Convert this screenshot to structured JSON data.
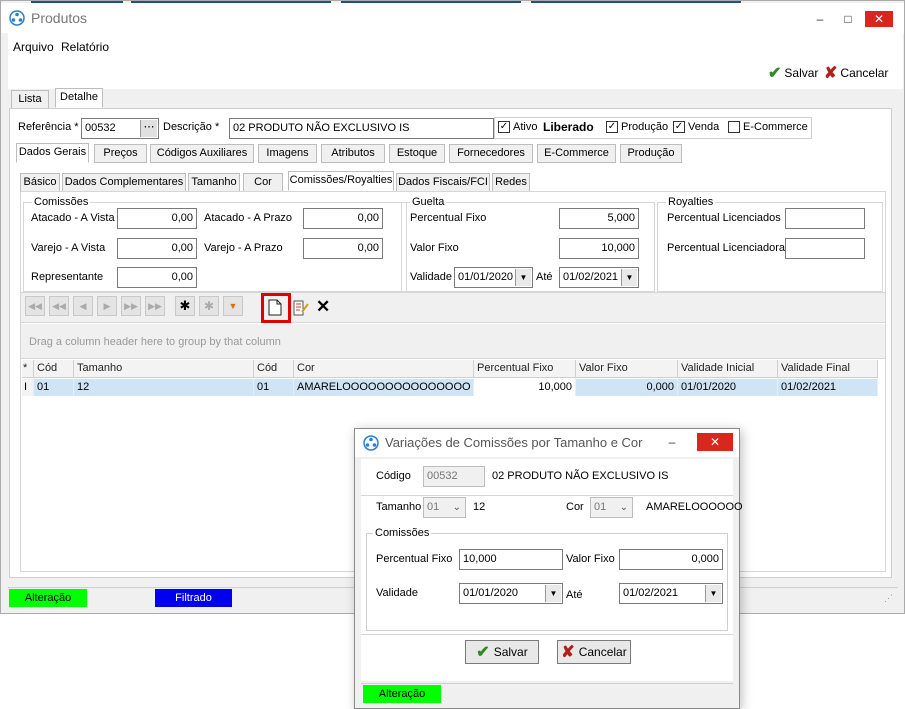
{
  "window": {
    "title": "Produtos"
  },
  "menu": {
    "arquivo": "Arquivo",
    "relatorio": "Relatório"
  },
  "toolbar": {
    "save_label": "Salvar",
    "cancel_label": "Cancelar"
  },
  "view_tabs": [
    "Lista",
    "Detalhe"
  ],
  "header": {
    "referencia_label": "Referência *",
    "referencia_value": "00532",
    "descricao_label": "Descrição *",
    "descricao_value": "02 PRODUTO NÃO EXCLUSIVO IS",
    "ativo_label": "Ativo",
    "status_text": "Liberado",
    "producao_label": "Produção",
    "venda_label": "Venda",
    "ecommerce_label": "E-Commerce"
  },
  "main_tabs": [
    "Dados Gerais",
    "Preços",
    "Códigos Auxiliares",
    "Imagens",
    "Atributos",
    "Estoque",
    "Fornecedores",
    "E-Commerce",
    "Produção"
  ],
  "sub_tabs": [
    "Básico",
    "Dados Complementares",
    "Tamanho",
    "Cor",
    "Comissões/Royalties",
    "Dados Fiscais/FCI",
    "Redes"
  ],
  "comissoes": {
    "title": "Comissões",
    "atacado_vista_label": "Atacado - A Vista",
    "atacado_vista": "0,00",
    "atacado_prazo_label": "Atacado - A Prazo",
    "atacado_prazo": "0,00",
    "varejo_vista_label": "Varejo - A Vista",
    "varejo_vista": "0,00",
    "varejo_prazo_label": "Varejo - A Prazo",
    "varejo_prazo": "0,00",
    "representante_label": "Representante",
    "representante": "0,00"
  },
  "guelta": {
    "title": "Guelta",
    "percentual_label": "Percentual Fixo",
    "percentual": "5,000",
    "valor_label": "Valor Fixo",
    "valor": "10,000",
    "validade_label": "Validade",
    "validade": "01/01/2020",
    "ate_label": "Até",
    "ate": "01/02/2021"
  },
  "royalties": {
    "title": "Royalties",
    "licenciados_label": "Percentual Licenciados",
    "licenciados": "",
    "licenciadora_label": "Percentual Licenciadora",
    "licenciadora": ""
  },
  "grid": {
    "group_hint": "Drag a column header here to group by that column",
    "columns": [
      "*",
      "Cód",
      "Tamanho",
      "Cód",
      "Cor",
      "Percentual Fixo",
      "Valor Fixo",
      "Validade Inicial",
      "Validade Final"
    ],
    "row": {
      "indicator": "I",
      "cod_tam": "01",
      "tamanho": "12",
      "cod_cor": "01",
      "cor": "AMARELOOOOOOOOOOOOOOO",
      "percentual": "10,000",
      "valor": "0,000",
      "val_ini": "01/01/2020",
      "val_fim": "01/02/2021"
    }
  },
  "status": {
    "alteracao": "Alteração",
    "filtrado": "Filtrado"
  },
  "colors": {
    "green": "#00ff00",
    "blue": "#0000ee",
    "accent": "#1e4f8f",
    "selection": "#cfe4f5"
  },
  "dialog": {
    "title": "Variações de Comissões por Tamanho e Cor",
    "codigo_label": "Código",
    "codigo": "00532",
    "descricao": "02 PRODUTO NÃO EXCLUSIVO IS",
    "tamanho_label": "Tamanho",
    "tamanho_cod": "01",
    "tamanho": "12",
    "cor_label": "Cor",
    "cor_cod": "01",
    "cor": "AMARELOOOOOO",
    "comissoes_title": "Comissões",
    "percentual_label": "Percentual Fixo",
    "percentual": "10,000",
    "valor_label": "Valor Fixo",
    "valor": "0,000",
    "validade_label": "Validade",
    "validade": "01/01/2020",
    "ate_label": "Até",
    "ate": "01/02/2021",
    "save_label": "Salvar",
    "cancel_label": "Cancelar",
    "status": "Alteração"
  }
}
